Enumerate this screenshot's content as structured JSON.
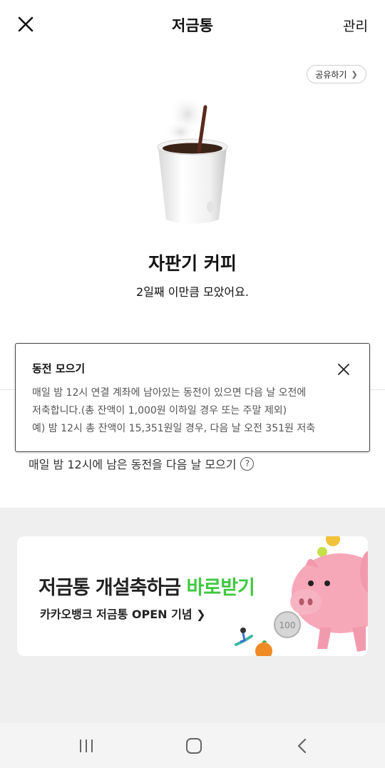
{
  "header": {
    "title": "저금통",
    "manage_label": "관리"
  },
  "share": {
    "label": "공유하기"
  },
  "item": {
    "name": "자판기 커피",
    "subtitle": "2일째 이만큼 모았어요."
  },
  "tooltip": {
    "title": "동전 모으기",
    "lines": [
      "매일 밤 12시 연결 계좌에 남아있는 동전이 있으면 다음 날 오전에",
      "저축합니다.(총 잔액이 1,000원 이하일 경우 또는 주말 제외)",
      "예) 밤 12시 총 잔액이 15,351원일 경우, 다음 날 오전 351원 저축"
    ]
  },
  "coin_setting": {
    "label": "매일 밤 12시에 남은 동전을 다음 날 모으기",
    "help": "?"
  },
  "banner": {
    "title_main": "저금통 개설축하금 ",
    "title_accent": "바로받기",
    "subtitle": "카카오뱅크 저금통 OPEN 기념 ❯",
    "coin_text": "100"
  },
  "colors": {
    "accent_green": "#3fc83f",
    "piggy_pink": "#f7a8b8",
    "gray_bg": "#efefef"
  },
  "icons": {
    "close": "close-icon",
    "share_chevron": "chevron-right-icon",
    "tooltip_close": "close-icon",
    "help": "question-icon",
    "nav_recent": "recent-apps-icon",
    "nav_home": "home-icon",
    "nav_back": "back-icon"
  }
}
